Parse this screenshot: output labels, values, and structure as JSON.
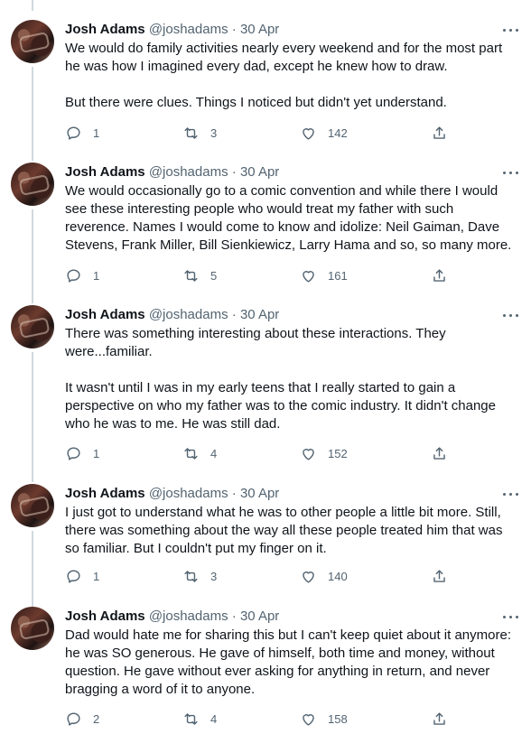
{
  "tweets": [
    {
      "name": "Josh Adams",
      "handle": "@joshadams",
      "separator": "·",
      "date": "30 Apr",
      "paragraphs": [
        "We would do family activities nearly every weekend and for the most part he was how I imagined every dad, except he knew how to draw.",
        "But there were clues. Things I noticed but didn't yet understand."
      ],
      "replies": "1",
      "retweets": "3",
      "likes": "142"
    },
    {
      "name": "Josh Adams",
      "handle": "@joshadams",
      "separator": "·",
      "date": "30 Apr",
      "paragraphs": [
        "We would occasionally go to a comic convention and while there I would see these interesting people who would treat my father with such reverence. Names I would come to know and idolize: Neil Gaiman, Dave Stevens, Frank Miller, Bill Sienkiewicz, Larry Hama and so, so many more."
      ],
      "replies": "1",
      "retweets": "5",
      "likes": "161"
    },
    {
      "name": "Josh Adams",
      "handle": "@joshadams",
      "separator": "·",
      "date": "30 Apr",
      "paragraphs": [
        "There was something interesting about these interactions. They were...familiar.",
        "It wasn't until I was in my early teens that I really started to gain a perspective on who my father was to the comic industry. It didn't change who he was to me. He was still dad."
      ],
      "replies": "1",
      "retweets": "4",
      "likes": "152"
    },
    {
      "name": "Josh Adams",
      "handle": "@joshadams",
      "separator": "·",
      "date": "30 Apr",
      "paragraphs": [
        "I just got to understand what he was to other people a little bit more. Still, there was something about the way all these people treated him that was so familiar. But I couldn't put my finger on it."
      ],
      "replies": "1",
      "retweets": "3",
      "likes": "140"
    },
    {
      "name": "Josh Adams",
      "handle": "@joshadams",
      "separator": "·",
      "date": "30 Apr",
      "paragraphs": [
        "Dad would hate me for sharing this but I can't keep quiet about it anymore: he was SO generous. He gave of himself, both time and money, without question. He gave without ever asking for anything in return, and never bragging a word of it to anyone."
      ],
      "replies": "2",
      "retweets": "4",
      "likes": "158"
    }
  ],
  "icons": {
    "reply": "reply-icon",
    "retweet": "retweet-icon",
    "like": "heart-icon",
    "share": "share-icon",
    "more": "more-options-icon"
  },
  "colors": {
    "text": "#0f1419",
    "secondary": "#536471",
    "thread_line": "#cfd9de"
  }
}
